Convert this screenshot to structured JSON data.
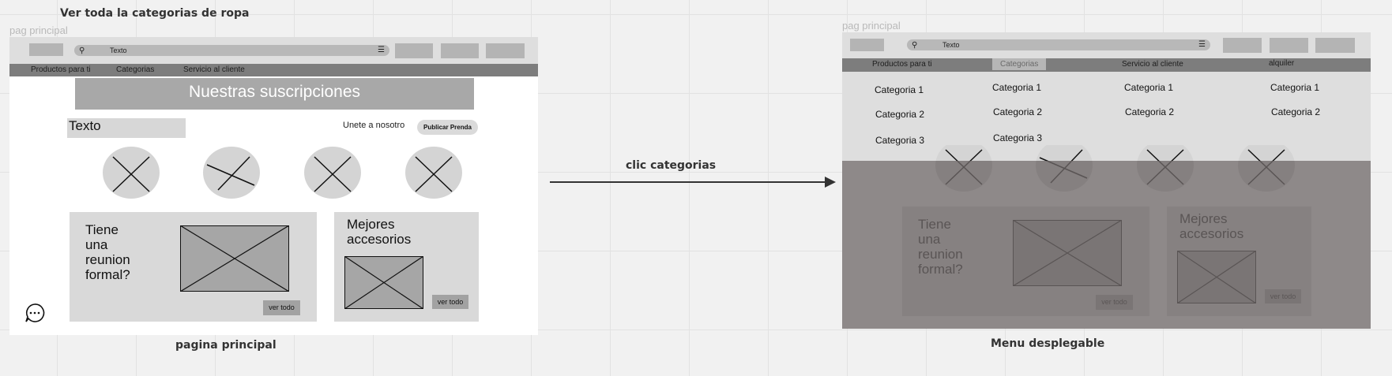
{
  "canvas": {
    "note_top": "Ver toda la categorias de ropa",
    "arrow_label": "clic categorias",
    "caption_left": "pagina principal",
    "caption_right": "Menu desplegable"
  },
  "frames": {
    "left_label": "pag principal",
    "right_label": "pag principal"
  },
  "header": {
    "search_text": "Texto",
    "search_icon": "search-icon",
    "filter_icon": "filter-icon"
  },
  "nav": {
    "items": [
      "Productos para ti",
      "Categorias",
      "Servicio al cliente",
      "alquiler"
    ]
  },
  "main": {
    "banner": "Nuestras suscripciones",
    "text_box": "Texto",
    "join_text": "Unete a nosotro",
    "publish_button": "Publicar Prenda",
    "card1_title": "Tiene una reunion formal?",
    "card1_lines": [
      "Tiene",
      "una",
      "reunion",
      "formal?"
    ],
    "card2_lines": [
      "Mejores",
      "accesorios"
    ],
    "see_all": "ver todo",
    "chat_icon": "chat-bubble-icon"
  },
  "dropdown": {
    "columns": [
      [
        "Categoria 1",
        "Categoria 2",
        "Categoria 3"
      ],
      [
        "Categoria 1",
        "Categoria 2",
        "Categoria 3"
      ],
      [
        "Categoria 1",
        "Categoria 2"
      ],
      [
        "Categoria 1",
        "Categoria 2"
      ]
    ]
  },
  "colors": {
    "canvas": "#f1f1f1",
    "frame": "#ffffff",
    "placeholder": "#b4b4b4",
    "navbar": "#7d7d7d",
    "overlay": "#6e6868"
  }
}
